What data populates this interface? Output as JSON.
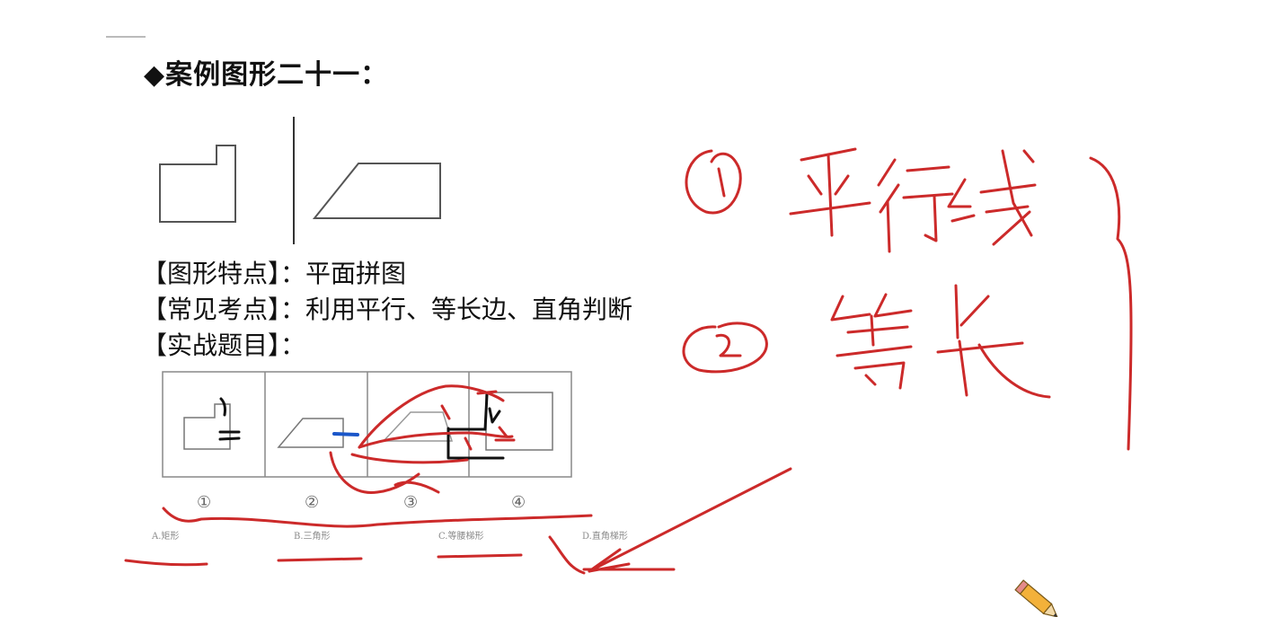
{
  "slide": {
    "title": "◆案例图形二十一：",
    "features": {
      "label": "【图形特点】",
      "value": "平面拼图"
    },
    "common_points": {
      "label": "【常见考点】",
      "value": "利用平行、等长边、直角判断"
    },
    "practice": {
      "label": "【实战题目】"
    },
    "separator": "：",
    "question_labels": [
      "①",
      "②",
      "③",
      "④"
    ],
    "options": [
      "A.矩形",
      "B.三角形",
      "C.等腰梯形",
      "D.直角梯形"
    ]
  },
  "annotations": {
    "ink_color": "#cc2a2a",
    "marker_blue": "#1a56c9"
  }
}
